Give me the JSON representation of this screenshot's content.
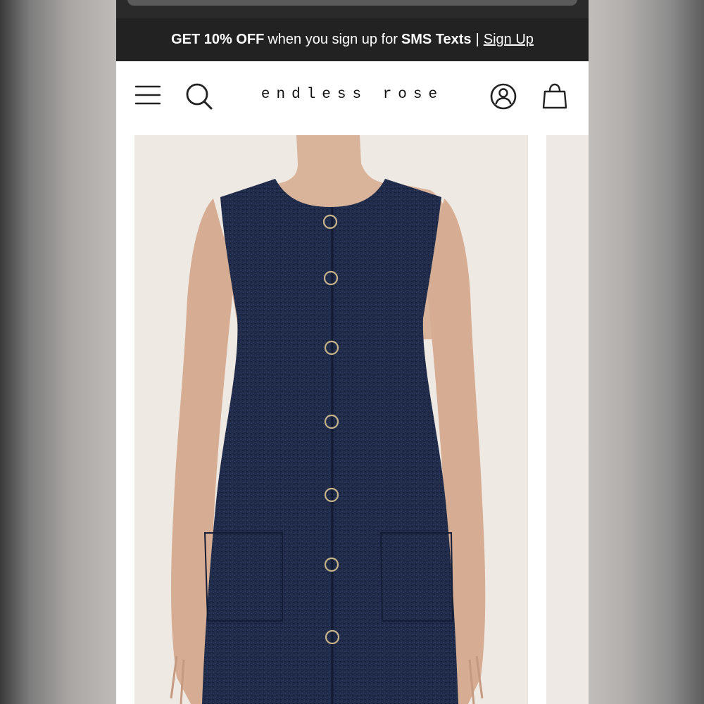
{
  "promo_banner": {
    "get_text": "GET 10% OFF",
    "middle_text": "when you sign up for",
    "sms_text": "SMS Texts",
    "separator": "|",
    "signup_link": "Sign Up"
  },
  "header": {
    "logo": "endless rose",
    "icons": [
      "menu-icon",
      "search-icon",
      "account-icon",
      "shopping-bag-icon"
    ]
  },
  "product": {
    "image_description_icon": "navy-tweed-sleeveless-button-front-mini-dress"
  },
  "colors": {
    "banner_bg": "#222222",
    "dress_navy": "#1f2b48",
    "button_gold": "#c8b48a",
    "image_bg": "#efe9e4"
  }
}
